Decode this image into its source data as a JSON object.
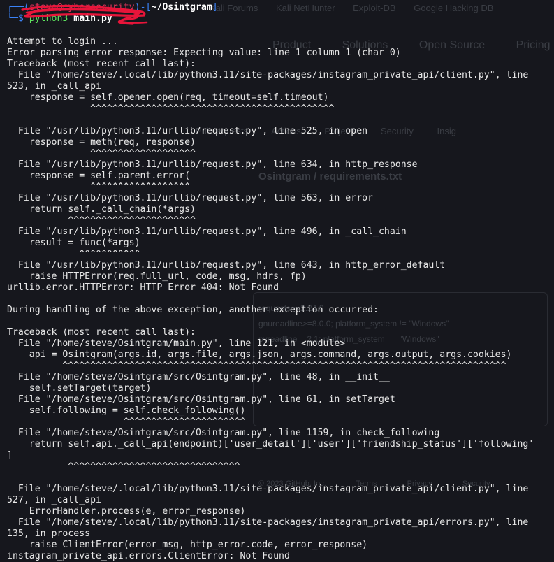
{
  "ghost_browser": {
    "bookmarks": [
      "Kali Forums",
      "Kali NetHunter",
      "Exploit-DB",
      "Google Hacking DB"
    ],
    "nav": [
      "Product",
      "Solutions",
      "Open Source",
      "Pricing"
    ],
    "tabs": [
      "Pull requests",
      "Actions",
      "Projects",
      "Security",
      "Insig"
    ],
    "path_repo": "Osintgram",
    "path_file": "requirements.txt",
    "code_lines": [
      "requests==2.24.0",
      "gnureadline>=8.0.0; platform_system != \"Windows\"",
      "pyreadline==2.1; platform_system == \"Windows\""
    ],
    "footer": [
      "© 2023 GitHub, Inc.",
      "Terms",
      "Privacy",
      "Security"
    ]
  },
  "prompt": {
    "user_host": "steve@cybersecurity",
    "cwd": "~/Osintgram",
    "command": "python3",
    "argument": "main.py"
  },
  "output_lines": [
    "Attempt to login ...",
    "Error parsing error response: Expecting value: line 1 column 1 (char 0)",
    "Traceback (most recent call last):",
    "  File \"/home/steve/.local/lib/python3.11/site-packages/instagram_private_api/client.py\", line",
    "523, in _call_api",
    "    response = self.opener.open(req, timeout=self.timeout)",
    "               ^^^^^^^^^^^^^^^^^^^^^^^^^^^^^^^^^^^^^^^^^^^^",
    "",
    "  File \"/usr/lib/python3.11/urllib/request.py\", line 525, in open",
    "    response = meth(req, response)",
    "               ^^^^^^^^^^^^^^^^^^^",
    "  File \"/usr/lib/python3.11/urllib/request.py\", line 634, in http_response",
    "    response = self.parent.error(",
    "               ^^^^^^^^^^^^^^^^^^",
    "  File \"/usr/lib/python3.11/urllib/request.py\", line 563, in error",
    "    return self._call_chain(*args)",
    "           ^^^^^^^^^^^^^^^^^^^^^^^",
    "  File \"/usr/lib/python3.11/urllib/request.py\", line 496, in _call_chain",
    "    result = func(*args)",
    "             ^^^^^^^^^^^",
    "  File \"/usr/lib/python3.11/urllib/request.py\", line 643, in http_error_default",
    "    raise HTTPError(req.full_url, code, msg, hdrs, fp)",
    "urllib.error.HTTPError: HTTP Error 404: Not Found",
    "",
    "During handling of the above exception, another exception occurred:",
    "",
    "Traceback (most recent call last):",
    "  File \"/home/steve/Osintgram/main.py\", line 121, in <module>",
    "    api = Osintgram(args.id, args.file, args.json, args.command, args.output, args.cookies)",
    "          ^^^^^^^^^^^^^^^^^^^^^^^^^^^^^^^^^^^^^^^^^^^^^^^^^^^^^^^^^^^^^^^^^^^^^^^^^^^^^^^^",
    "  File \"/home/steve/Osintgram/src/Osintgram.py\", line 48, in __init__",
    "    self.setTarget(target)",
    "  File \"/home/steve/Osintgram/src/Osintgram.py\", line 61, in setTarget",
    "    self.following = self.check_following()",
    "                     ^^^^^^^^^^^^^^^^^^^^^^",
    "  File \"/home/steve/Osintgram/src/Osintgram.py\", line 1159, in check_following",
    "    return self.api._call_api(endpoint)['user_detail']['user']['friendship_status']['following'",
    "]",
    "           ^^^^^^^^^^^^^^^^^^^^^^^^^^^^^^^",
    "",
    "  File \"/home/steve/.local/lib/python3.11/site-packages/instagram_private_api/client.py\", line",
    "527, in _call_api",
    "    ErrorHandler.process(e, error_response)",
    "  File \"/home/steve/.local/lib/python3.11/site-packages/instagram_private_api/errors.py\", line",
    "135, in process",
    "    raise ClientError(error_msg, http_error.code, error_response)",
    "instagram_private_api.errors.ClientError: Not Found"
  ]
}
